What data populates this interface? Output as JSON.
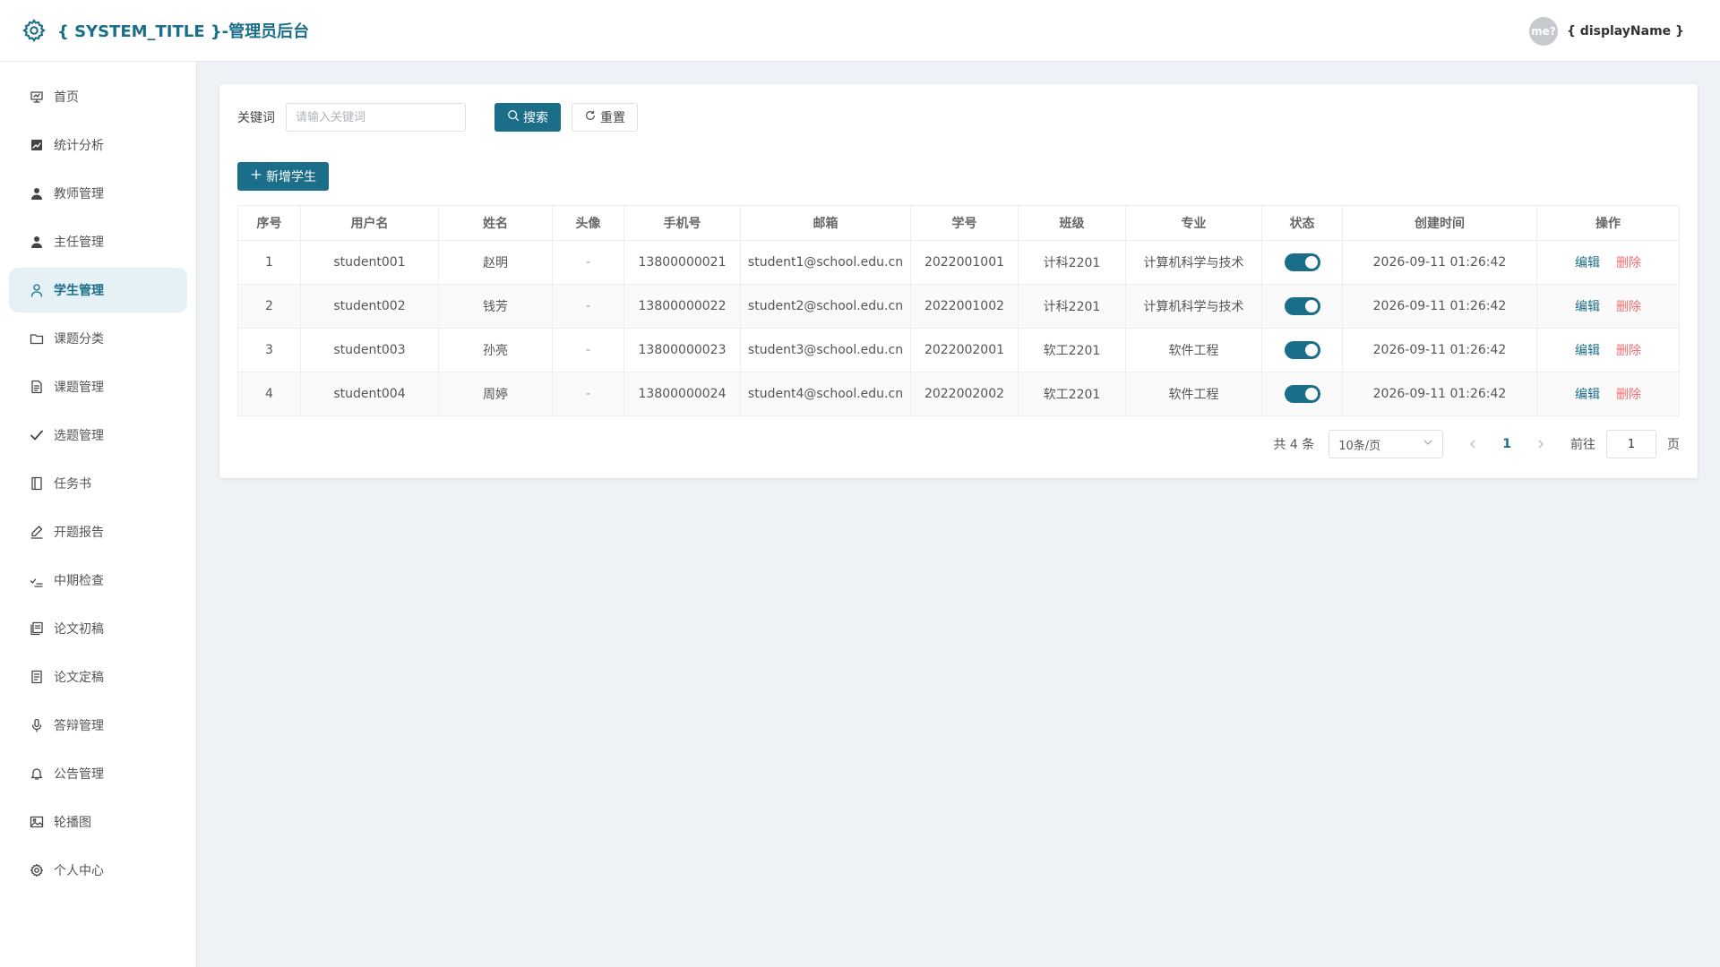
{
  "header": {
    "title": "{ SYSTEM_TITLE }-管理员后台",
    "avatar_text": "me?",
    "display_name": "{ displayName }"
  },
  "sidebar": {
    "items": [
      {
        "label": "首页",
        "icon": "home-icon"
      },
      {
        "label": "统计分析",
        "icon": "chart-icon"
      },
      {
        "label": "教师管理",
        "icon": "user-icon"
      },
      {
        "label": "主任管理",
        "icon": "user-icon"
      },
      {
        "label": "学生管理",
        "icon": "user-outline-icon",
        "active": true
      },
      {
        "label": "课题分类",
        "icon": "folder-icon"
      },
      {
        "label": "课题管理",
        "icon": "document-icon"
      },
      {
        "label": "选题管理",
        "icon": "check-icon"
      },
      {
        "label": "任务书",
        "icon": "notebook-icon"
      },
      {
        "label": "开题报告",
        "icon": "edit-pen-icon"
      },
      {
        "label": "中期检查",
        "icon": "checklist-icon"
      },
      {
        "label": "论文初稿",
        "icon": "copy-document-icon"
      },
      {
        "label": "论文定稿",
        "icon": "tickets-icon"
      },
      {
        "label": "答辩管理",
        "icon": "microphone-icon"
      },
      {
        "label": "公告管理",
        "icon": "bell-icon"
      },
      {
        "label": "轮播图",
        "icon": "picture-icon"
      },
      {
        "label": "个人中心",
        "icon": "setting-icon"
      }
    ]
  },
  "filter": {
    "keyword_label": "关键词",
    "keyword_placeholder": "请输入关键词",
    "keyword_value": "",
    "search_label": "搜索",
    "reset_label": "重置"
  },
  "toolbar": {
    "add_label": "新增学生"
  },
  "table": {
    "columns": [
      "序号",
      "用户名",
      "姓名",
      "头像",
      "手机号",
      "邮箱",
      "学号",
      "班级",
      "专业",
      "状态",
      "创建时间",
      "操作"
    ],
    "rows": [
      {
        "index": "1",
        "username": "student001",
        "name": "赵明",
        "avatar": "-",
        "phone": "13800000021",
        "email": "student1@school.edu.cn",
        "student_no": "2022001001",
        "class": "计科2201",
        "major": "计算机科学与技术",
        "status": true,
        "created": "2026-09-11 01:26:42"
      },
      {
        "index": "2",
        "username": "student002",
        "name": "钱芳",
        "avatar": "-",
        "phone": "13800000022",
        "email": "student2@school.edu.cn",
        "student_no": "2022001002",
        "class": "计科2201",
        "major": "计算机科学与技术",
        "status": true,
        "created": "2026-09-11 01:26:42"
      },
      {
        "index": "3",
        "username": "student003",
        "name": "孙亮",
        "avatar": "-",
        "phone": "13800000023",
        "email": "student3@school.edu.cn",
        "student_no": "2022002001",
        "class": "软工2201",
        "major": "软件工程",
        "status": true,
        "created": "2026-09-11 01:26:42"
      },
      {
        "index": "4",
        "username": "student004",
        "name": "周婷",
        "avatar": "-",
        "phone": "13800000024",
        "email": "student4@school.edu.cn",
        "student_no": "2022002002",
        "class": "软工2201",
        "major": "软件工程",
        "status": true,
        "created": "2026-09-11 01:26:42"
      }
    ],
    "edit_label": "编辑",
    "delete_label": "删除"
  },
  "pagination": {
    "total_text": "共 4 条",
    "page_size": "10条/页",
    "current_page": "1",
    "goto_label": "前往",
    "goto_value": "1",
    "goto_suffix": "页"
  },
  "colors": {
    "accent": "#1a6e8a",
    "danger": "#f56c6c",
    "active_bg": "#e6f1f5"
  }
}
